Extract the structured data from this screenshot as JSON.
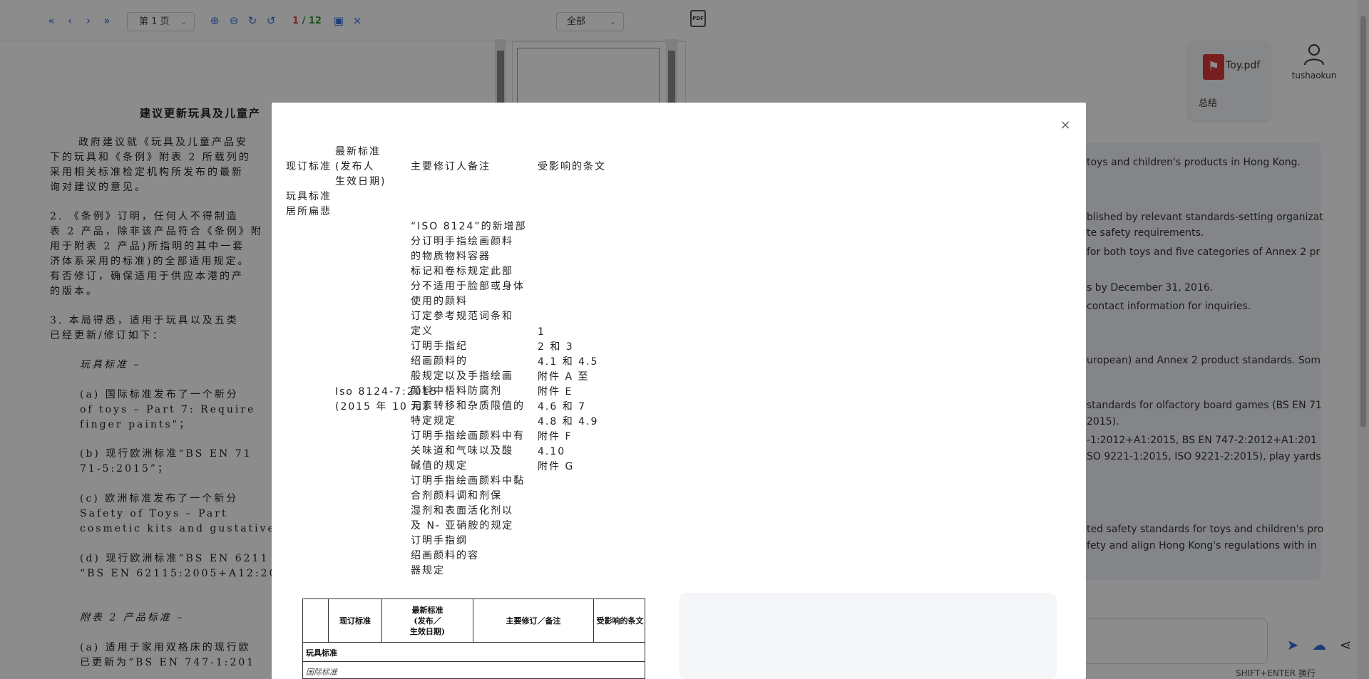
{
  "pdf_toolbar": {
    "first_icon": "double-chevron-left-icon",
    "prev_icon": "chevron-left-icon",
    "next_icon": "chevron-right-icon",
    "last_icon": "double-chevron-right-icon",
    "page_select": "第 1 页",
    "zoom_in_icon": "zoom-in-icon",
    "zoom_out_icon": "zoom-out-icon",
    "rotate_icon": "rotate-icon",
    "reset_icon": "reset-icon",
    "page_current": "1",
    "page_total": "/ 12",
    "image_icon": "image-icon",
    "close_icon": "close-icon",
    "filter_select": "全部",
    "export_label": "PDF"
  },
  "document": {
    "title": "建议更新玩具及儿童产",
    "lines": [
      "政府建议就《玩具及儿童产品安",
      "下的玩具和《条例》附表 2 所载列的",
      "采用相关标准检定机构所发布的最新",
      "询对建议的意见。",
      "2.  《条例》订明，任何人不得制造",
      "表 2 产品，除非该产品符合《条例》附",
      "用于附表 2 产品)所指明的其中一套",
      "济体系采用的标准)的全部适用规定。",
      "有否修订，确保适用于供应本港的产",
      "的版本。",
      "3.  本局得悉，适用于玩具以及五类",
      "已经更新/修订如下：",
      "玩具标准 –",
      "(a)   国际标准发布了一个新分",
      "      of toys – Part 7: Require",
      "      finger paints\"；",
      "(b)   现行欧洲标准“BS EN 71",
      "      71-5:2015”；",
      "(c)   欧洲标准发布了一个新分",
      "      Safety of Toys – Part",
      "      cosmetic kits and gustative",
      "(d)   现行欧洲标准“BS EN 6211",
      "      “BS EN 62115:2005+A12:20",
      "附表 2 产品标准 –",
      "(a)   适用于家用双格床的现行欧",
      "      已更新为“BS EN 747-1:201"
    ]
  },
  "chat": {
    "file_name": "Toy.pdf",
    "file_summary": "总结",
    "user_name": "tushaokun",
    "summary_lines": [
      "toys and children's products in Hong Kong.",
      "blished by relevant standards-setting organizat",
      "te safety requirements.",
      "for both toys and five categories of Annex 2 pr",
      "s by December 31, 2016.",
      "contact information for inquiries.",
      "uropean) and Annex 2 product standards. Som",
      "standards for olfactory board games (BS EN 71",
      "2015).",
      "-1:2012+A1:2015, BS EN 747-2:2012+A1:201",
      "SO 9221-1:2015, ISO 9221-2:2015), play yards",
      "ted safety standards for toys and children's pro",
      "fety and align Hong Kong's regulations with in"
    ],
    "hint": "SHIFT+ENTER 换行",
    "send_icon": "send-icon",
    "upload_icon": "cloud-upload-icon",
    "share_icon": "share-icon"
  },
  "modal": {
    "close_icon": "close-icon",
    "col_current": "现订标准",
    "col_latest_1": "最新标准",
    "col_latest_2": "(发布人",
    "col_latest_3": "生效日期)",
    "col_notes": "主要修订人备注",
    "col_affected": "受影响的条文",
    "row_toy_1": "玩具标准",
    "row_toy_2": "居所扁悲",
    "std_name": "Iso 8124-7:2015",
    "std_date": "(2015 年 10 月)",
    "notes": [
      "“ISO 8124”的新增部",
      "分订明手指绘画颜料",
      "的物质物料容器",
      "标记和卷标规定此部",
      "分不适用于脸部或身体",
      "使用的颜料",
      "订定参考规范词条和",
      "定义",
      "订明手指纪",
      "绍画颜料的",
      "般规定以及手指绘画",
      "颜料中梧料防腐剂",
      "元素转移和杂质限值的",
      "特定规定",
      "订明手指绘画颜料中有",
      "关味道和气味以及酸",
      "碱值的规定",
      "订明手指绘画颜料中黏",
      "合剂颜料调和剂保",
      "湿剂和表面活化剂以",
      "及 N- 亚硝胺的规定",
      "订明手指纲",
      "绍画颜料的容",
      "器规定"
    ],
    "affected": [
      "1",
      "2 和 3",
      "4.1 和 4.5",
      "附件 A 至",
      "附件 E",
      "4.6 和 7",
      "4.8 和 4.9",
      "附件 F",
      "4.10",
      "附件 G"
    ],
    "table_image": {
      "h_current": "现订标准",
      "h_latest_1": "最新标准",
      "h_latest_2": "(发布／",
      "h_latest_3": "生效日期)",
      "h_notes": "主要修订／备注",
      "h_affected": "受影响的条文",
      "row_toy": "玩具标准",
      "row_intl": "国际标准"
    }
  }
}
